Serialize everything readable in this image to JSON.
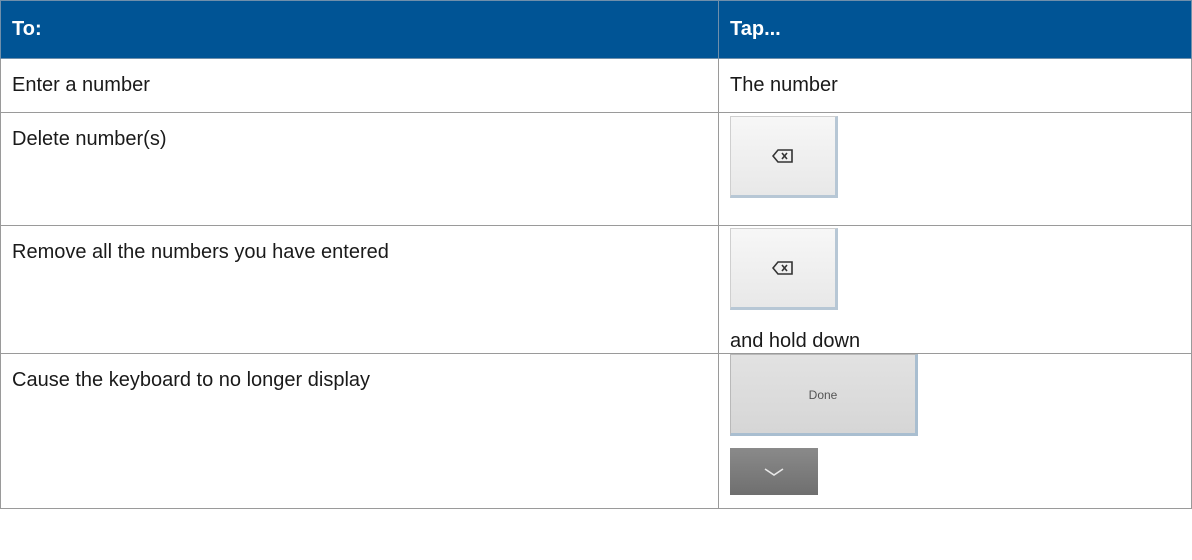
{
  "table": {
    "headers": {
      "col1": "To:",
      "col2": "Tap..."
    },
    "rows": [
      {
        "action": "Enter a number",
        "tap_text": "The number"
      },
      {
        "action": "Delete number(s)",
        "tap_icon": "backspace-icon"
      },
      {
        "action": "Remove all the numbers you have entered",
        "tap_icon": "backspace-icon",
        "tap_note": "and hold down"
      },
      {
        "action": "Cause the keyboard to no longer display",
        "done_label": "Done",
        "tap_icon": "keyboard-hide-chevron-icon"
      }
    ]
  },
  "colors": {
    "header_bg": "#005495",
    "header_text": "#ffffff",
    "grid_line": "#9a9a9a"
  }
}
